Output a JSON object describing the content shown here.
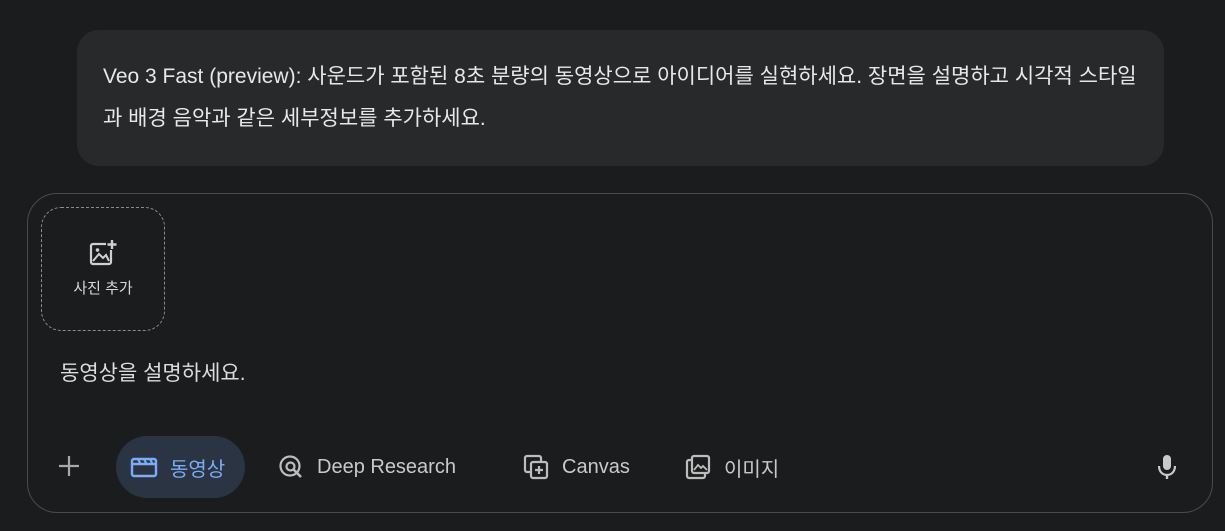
{
  "notice": {
    "text": "Veo 3 Fast (preview): 사운드가 포함된 8초 분량의 동영상으로 아이디어를 실현하세요. 장면을 설명하고 시각적 스타일과 배경 음악과 같은 세부정보를 추가하세요."
  },
  "composer": {
    "add_photo_label": "사진 추가",
    "add_photo_icon": "add-photo-icon",
    "input_value": "",
    "input_placeholder": "동영상을 설명하세요."
  },
  "toolbar": {
    "plus_icon": "plus-icon",
    "tools": [
      {
        "label": "동영상",
        "icon": "video-icon",
        "active": true
      },
      {
        "label": "Deep Research",
        "icon": "deep-research-icon",
        "active": false
      },
      {
        "label": "Canvas",
        "icon": "canvas-icon",
        "active": false
      },
      {
        "label": "이미지",
        "icon": "image-icon",
        "active": false
      }
    ],
    "mic_icon": "microphone-icon"
  },
  "colors": {
    "background": "#1b1c1d",
    "notice_bg": "#28292b",
    "active_chip_bg": "#2a3442",
    "accent": "#7cacf8",
    "text": "#e3e3e3",
    "muted_text": "#c9c9c9"
  }
}
